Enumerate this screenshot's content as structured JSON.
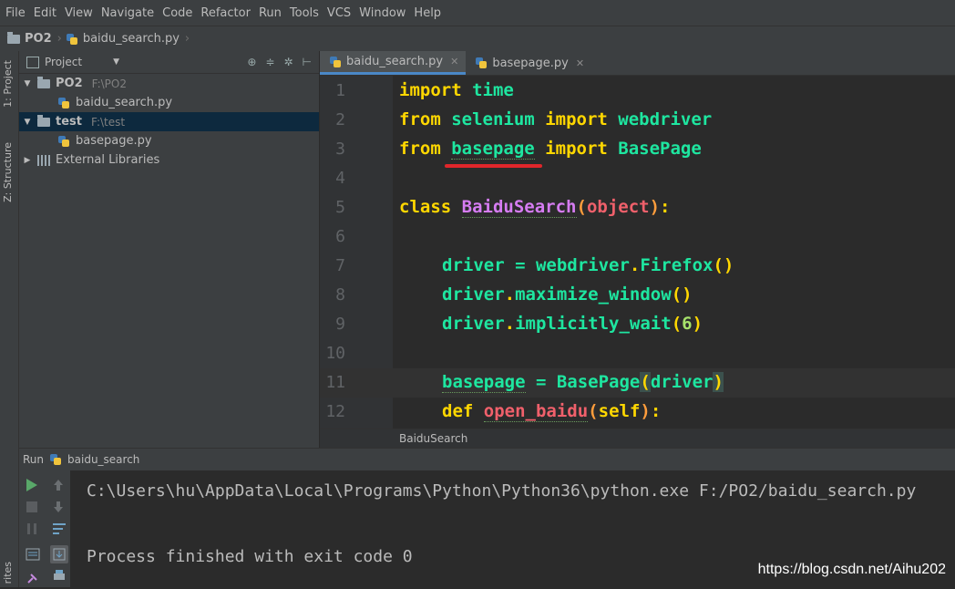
{
  "menu": [
    "File",
    "Edit",
    "View",
    "Navigate",
    "Code",
    "Refactor",
    "Run",
    "Tools",
    "VCS",
    "Window",
    "Help"
  ],
  "navbar": {
    "project": "PO2",
    "file": "baidu_search.py"
  },
  "sidebar_tabs": {
    "project": "1: Project",
    "structure": "Z: Structure",
    "favorites": "rites"
  },
  "project_panel": {
    "title": "Project",
    "tree": [
      {
        "name": "PO2",
        "path": "F:\\PO2"
      },
      {
        "name": "baidu_search.py"
      },
      {
        "name": "test",
        "path": "F:\\test"
      },
      {
        "name": "basepage.py"
      },
      {
        "name": "External Libraries"
      }
    ]
  },
  "editor_tabs": [
    {
      "label": "baidu_search.py"
    },
    {
      "label": "basepage.py"
    }
  ],
  "code_lines": [
    {
      "n": "1"
    },
    {
      "n": "2"
    },
    {
      "n": "3"
    },
    {
      "n": "4"
    },
    {
      "n": "5"
    },
    {
      "n": "6"
    },
    {
      "n": "7"
    },
    {
      "n": "8"
    },
    {
      "n": "9"
    },
    {
      "n": "10"
    },
    {
      "n": "11"
    },
    {
      "n": "12"
    }
  ],
  "code_text": {
    "l1a": "import",
    "l1b": "time",
    "l2a": "from",
    "l2b": "selenium",
    "l2c": "import",
    "l2d": "webdriver",
    "l3a": "from",
    "l3b": "basepage",
    "l3c": "import",
    "l3d": "BasePage",
    "l5a": "class",
    "l5b": "BaiduSearch",
    "l5c": "(",
    "l5d": "object",
    "l5e": ")",
    ":": ":",
    "l7a": "driver",
    "l7b": " = ",
    "l7c": "webdriver",
    "l7d": ".",
    "l7e": "Firefox",
    "l7f": "()",
    "l8a": "driver",
    "l8b": ".",
    "l8c": "maximize_window",
    "l8d": "()",
    "l9a": "driver",
    "l9b": ".",
    "l9c": "implicitly_wait",
    "l9d": "(",
    "l9e": "6",
    "l9f": ")",
    "l11a": "basepage",
    "l11b": " = ",
    "l11c": "BasePage",
    "l11d": "(",
    "l11e": "driver",
    "l11f": ")",
    "l12a": "def",
    "l12b": "open_baidu",
    "l12c": "(",
    "l12d": "self",
    "l12e": ")"
  },
  "editor_breadcrumb": "BaiduSearch",
  "run": {
    "label": "Run",
    "config": "baidu_search"
  },
  "console": {
    "line1": "C:\\Users\\hu\\AppData\\Local\\Programs\\Python\\Python36\\python.exe F:/PO2/baidu_search.py",
    "line2": "Process finished with exit code 0"
  },
  "watermark": "https://blog.csdn.net/Aihu202"
}
